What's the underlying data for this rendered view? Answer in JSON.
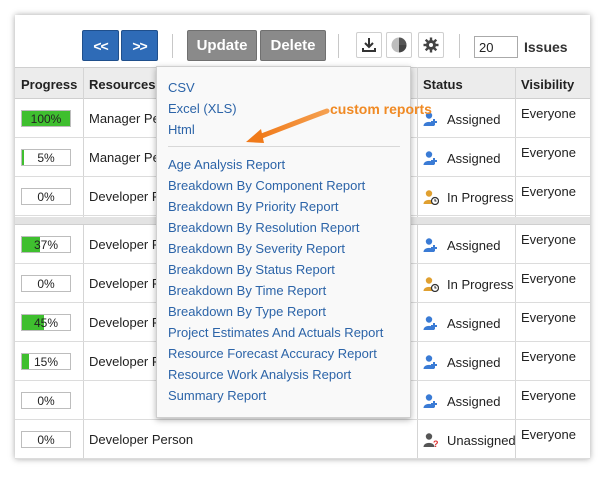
{
  "toolbar": {
    "prev_label": "<<",
    "next_label": ">>",
    "update_label": "Update",
    "delete_label": "Delete",
    "export_icon": "download-icon",
    "report_icon": "pie-chart-icon",
    "settings_icon": "gear-icon",
    "page_size_value": "20",
    "page_size_label": "Issues"
  },
  "table": {
    "headers": {
      "progress": "Progress",
      "resources": "Resources",
      "status": "Status",
      "visibility": "Visibility"
    },
    "rows": [
      {
        "progress": "100%",
        "fill": 1.0,
        "resource": "Manager Pe",
        "status": "Assigned",
        "status_icon": "user-assigned-icon",
        "visibility": "Everyone"
      },
      {
        "progress": "5%",
        "fill": 0.05,
        "resource": "Manager Pe",
        "status": "Assigned",
        "status_icon": "user-assigned-icon",
        "visibility": "Everyone"
      },
      {
        "progress": "0%",
        "fill": 0.0,
        "resource": "Developer P",
        "status": "In Progress",
        "status_icon": "user-in-progress-icon",
        "visibility": "Everyone"
      },
      {
        "progress": "37%",
        "fill": 0.37,
        "resource": "Developer P",
        "status": "Assigned",
        "status_icon": "user-assigned-icon",
        "visibility": "Everyone"
      },
      {
        "progress": "0%",
        "fill": 0.0,
        "resource": "Developer P",
        "status": "In Progress",
        "status_icon": "user-in-progress-icon",
        "visibility": "Everyone"
      },
      {
        "progress": "45%",
        "fill": 0.45,
        "resource": "Developer P",
        "status": "Assigned",
        "status_icon": "user-assigned-icon",
        "visibility": "Everyone"
      },
      {
        "progress": "15%",
        "fill": 0.15,
        "resource": "Developer P",
        "status": "Assigned",
        "status_icon": "user-assigned-icon",
        "visibility": "Everyone"
      },
      {
        "progress": "0%",
        "fill": 0.0,
        "resource": "",
        "status": "Assigned",
        "status_icon": "user-assigned-icon",
        "visibility": "Everyone"
      },
      {
        "progress": "0%",
        "fill": 0.0,
        "resource": "Developer Person",
        "status": "Unassigned",
        "status_icon": "user-unassigned-icon",
        "visibility": "Everyone"
      }
    ]
  },
  "export_menu": {
    "formats": [
      "CSV",
      "Excel (XLS)",
      "Html"
    ],
    "reports": [
      "Age Analysis Report",
      "Breakdown By Component Report",
      "Breakdown By Priority Report",
      "Breakdown By Resolution Report",
      "Breakdown By Severity Report",
      "Breakdown By Status Report",
      "Breakdown By Time Report",
      "Breakdown By Type Report",
      "Project Estimates And Actuals Report",
      "Resource Forecast Accuracy Report",
      "Resource Work Analysis Report",
      "Summary Report"
    ]
  },
  "annotation": {
    "text": "custom reports",
    "color": "#f08a24"
  },
  "colors": {
    "button_blue": "#2e6bb7",
    "button_gray": "#8a8a8a",
    "progress_green": "#3fbf2f",
    "link_blue": "#2c64a8",
    "assigned_icon": "#3a7bd5",
    "in_progress_icon": "#e0a030",
    "unassigned_icon": "#555555"
  }
}
